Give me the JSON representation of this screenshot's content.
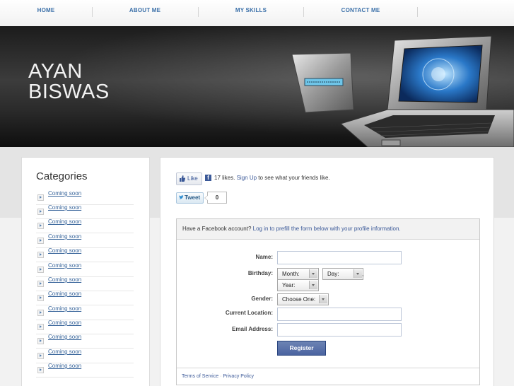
{
  "nav": {
    "items": [
      "HOME",
      "ABOUT ME",
      "MY SKILLS",
      "CONTACT ME"
    ]
  },
  "hero": {
    "name_line1": "AYAN",
    "name_line2": "BISWAS"
  },
  "sidebar": {
    "title": "Categories",
    "items": [
      "Coming soon",
      "Coming soon",
      "Coming soon",
      "Coming soon",
      "Coming soon",
      "Coming soon",
      "Coming soon",
      "Coming soon",
      "Coming soon",
      "Coming soon",
      "Coming soon",
      "Coming soon",
      "Coming soon"
    ]
  },
  "social": {
    "like_label": "Like",
    "fb_icon": "f",
    "like_count_text": "17 likes.",
    "signup_link": "Sign Up",
    "like_suffix": "to see what your friends like.",
    "tweet_label": "Tweet",
    "tweet_count": "0"
  },
  "registration": {
    "header_text": "Have a Facebook account?",
    "header_link": "Log in to prefill the form below with your profile information.",
    "name_label": "Name:",
    "birthday_label": "Birthday:",
    "month_value": "Month:",
    "day_value": "Day:",
    "year_value": "Year:",
    "gender_label": "Gender:",
    "gender_value": "Choose One:",
    "location_label": "Current Location:",
    "email_label": "Email Address:",
    "register_label": "Register",
    "terms_link": "Terms of Service",
    "separator": "·",
    "privacy_link": "Privacy Policy"
  },
  "colors": {
    "link": "#3b5998",
    "nav_text": "#3a6fa8",
    "button_bg": "#5b74a8"
  }
}
